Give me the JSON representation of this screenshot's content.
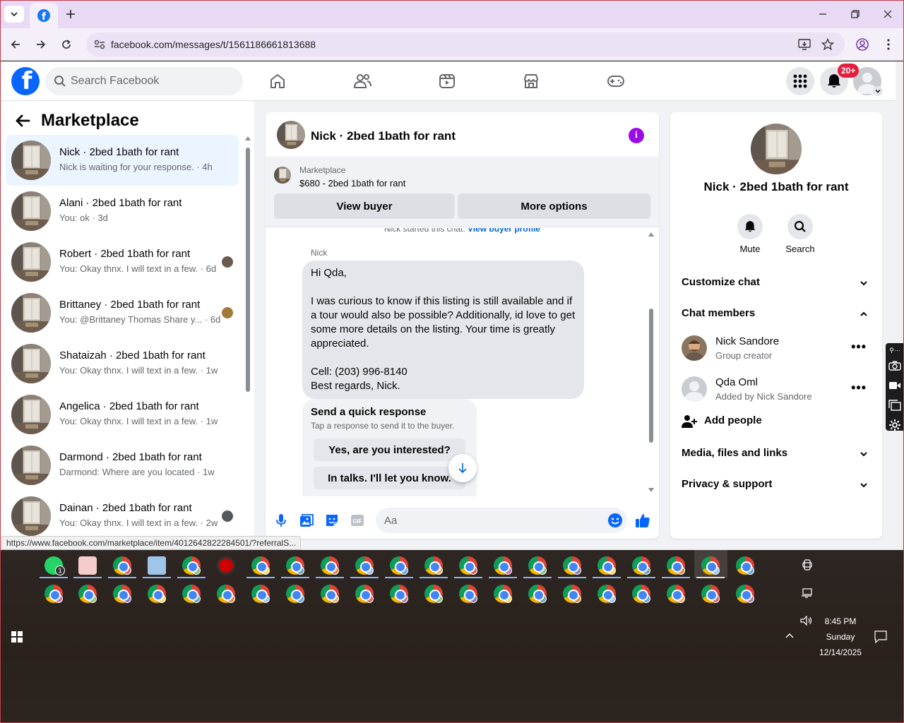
{
  "browser": {
    "url": "facebook.com/messages/t/1561186661813688",
    "status_url": "https://www.facebook.com/marketplace/item/4012642822284501/?referralS..."
  },
  "fb": {
    "search_placeholder": "Search Facebook",
    "notification_count": "20+"
  },
  "left": {
    "title": "Marketplace",
    "conversations": [
      {
        "title": "Nick · 2bed 1bath for rant",
        "preview": "Nick is waiting for your response. · 4h",
        "active": true
      },
      {
        "title": "Alani · 2bed 1bath for rant",
        "preview": "You: ok · 3d"
      },
      {
        "title": "Robert · 2bed 1bath for rant",
        "preview": "You: Okay thnx. I will text in a few. · 6d"
      },
      {
        "title": "Brittaney · 2bed 1bath for rant",
        "preview": "You: @Brittaney Thomas Share y... · 6d"
      },
      {
        "title": "Shataizah · 2bed 1bath for rant",
        "preview": "You: Okay thnx. I will text in a few. · 1w"
      },
      {
        "title": "Angelica · 2bed 1bath for rant",
        "preview": "You: Okay thnx. I will text in a few. · 1w"
      },
      {
        "title": "Darmond · 2bed 1bath for rant",
        "preview": "Darmond: Where are you located · 1w"
      },
      {
        "title": "Dainan · 2bed 1bath for rant",
        "preview": "You: Okay thnx. I will text in a few. · 2w"
      }
    ]
  },
  "chat": {
    "title": "Nick · 2bed 1bath for rant",
    "listing_label": "Marketplace",
    "listing_price": "$680 - 2bed 1bath for rant",
    "view_buyer": "View buyer",
    "more_options": "More options",
    "started_text": "Nick started this chat.",
    "started_link": "View buyer profile",
    "sender": "Nick",
    "message": "Hi Qda,\n\nI was curious to know if this listing is still available and if a tour would also be possible? Additionally, id love to get some more details on the listing. Your time is greatly appreciated.\n\nCell: (203) 996-8140\nBest regards, Nick.",
    "quick_title": "Send a quick response",
    "quick_sub": "Tap a response to send it to the buyer.",
    "quick_opt1": "Yes, are you interested?",
    "quick_opt2": "In talks. I'll let you know.",
    "composer_placeholder": "Aa"
  },
  "right": {
    "title": "Nick · 2bed 1bath for rant",
    "mute": "Mute",
    "search": "Search",
    "customize": "Customize chat",
    "members_header": "Chat members",
    "members": [
      {
        "name": "Nick Sandore",
        "role": "Group creator"
      },
      {
        "name": "Qda Oml",
        "role": "Added by Nick Sandore"
      }
    ],
    "add_people": "Add people",
    "media": "Media, files and links",
    "privacy": "Privacy & support"
  },
  "taskbar": {
    "whatsapp_badge": "1",
    "time": "8:45 PM",
    "day": "Sunday",
    "date": "12/14/2025"
  }
}
